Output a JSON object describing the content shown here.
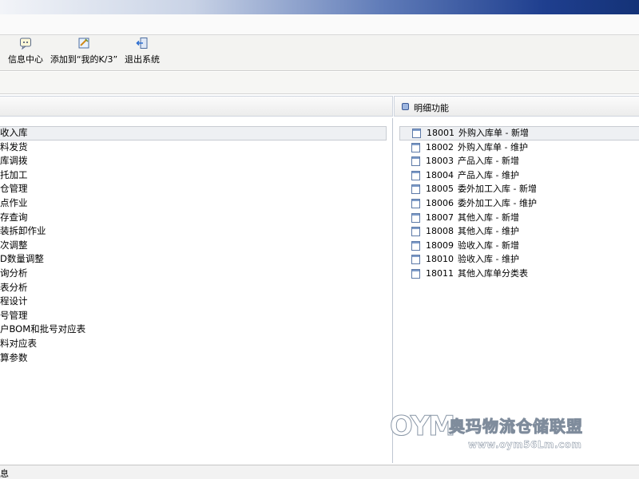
{
  "toolbar": {
    "buttons": [
      {
        "label": "信息中心",
        "icon": "info-center-icon"
      },
      {
        "label": "添加到“我的K/3”",
        "icon": "add-favorite-icon"
      },
      {
        "label": "退出系统",
        "icon": "exit-icon"
      }
    ]
  },
  "right_header": {
    "title": "明细功能"
  },
  "categories": [
    "收入库",
    "料发货",
    "库调拨",
    "托加工",
    "仓管理",
    "点作业",
    "存查询",
    "装拆卸作业",
    "次调整",
    "D数量调整",
    "询分析",
    "表分析",
    "程设计",
    "号管理",
    "户BOM和批号对应表",
    "料对应表",
    "算参数"
  ],
  "functions": [
    {
      "code": "18001",
      "name": "外购入库单 - 新增"
    },
    {
      "code": "18002",
      "name": "外购入库单 - 维护"
    },
    {
      "code": "18003",
      "name": "产品入库 - 新增"
    },
    {
      "code": "18004",
      "name": "产品入库 - 维护"
    },
    {
      "code": "18005",
      "name": "委外加工入库 - 新增"
    },
    {
      "code": "18006",
      "name": "委外加工入库 - 维护"
    },
    {
      "code": "18007",
      "name": "其他入库 - 新增"
    },
    {
      "code": "18008",
      "name": "其他入库 - 维护"
    },
    {
      "code": "18009",
      "name": "验收入库 - 新增"
    },
    {
      "code": "18010",
      "name": "验收入库 - 维护"
    },
    {
      "code": "18011",
      "name": "其他入库单分类表"
    }
  ],
  "status": {
    "text": "息"
  },
  "watermark": {
    "logo": "OYM",
    "title": "奥玛物流仓储联盟",
    "url": "www.oym56Lm.com"
  }
}
